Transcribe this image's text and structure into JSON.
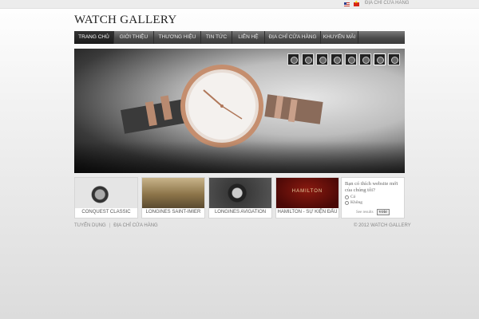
{
  "topbar": {
    "store_link": "Địa chỉ cửa hàng"
  },
  "logo": "WATCH GALLERY",
  "nav": [
    {
      "label": "Trang chủ",
      "width": 50,
      "active": true
    },
    {
      "label": "Giới thiệu",
      "width": 50
    },
    {
      "label": "Thương hiệu",
      "width": 59
    },
    {
      "label": "Tin tức",
      "width": 39
    },
    {
      "label": "Liên hệ",
      "width": 41
    },
    {
      "label": "Địa chỉ cửa hàng",
      "width": 70
    },
    {
      "label": "Khuyến mãi",
      "width": 47
    }
  ],
  "banner": {
    "thumb_count": 8,
    "selected_thumb": 7
  },
  "tiles": [
    {
      "caption": "Conquest Classic"
    },
    {
      "caption": "Longines Saint-Imier"
    },
    {
      "caption": "Longines Avigation"
    },
    {
      "caption": "Hamilton - sự kiện đấu",
      "brand": "HAMILTON"
    }
  ],
  "poll": {
    "question": "Bạn có thích website mới của chúng tôi?",
    "options": [
      "Có",
      "Không"
    ],
    "results_label": "See results",
    "vote_label": "vote"
  },
  "footer": {
    "links": [
      "Tuyển dụng",
      "Địa chỉ cửa hàng"
    ],
    "copyright": "© 2012 Watch Gallery"
  }
}
